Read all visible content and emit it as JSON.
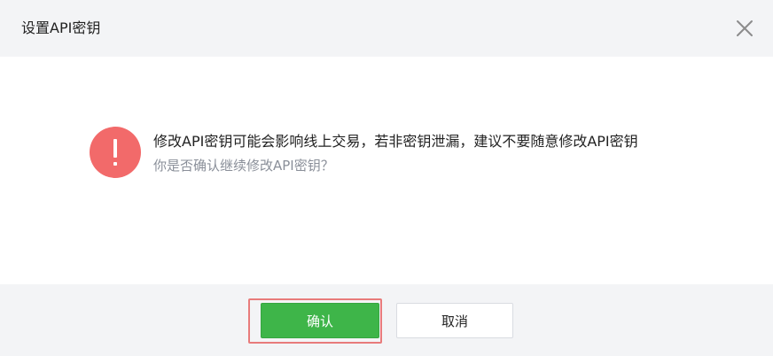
{
  "dialog": {
    "title": "设置API密钥",
    "close_icon": "close-icon",
    "warning_icon": "exclamation-icon",
    "message_main": "修改API密钥可能会影响线上交易，若非密钥泄漏，建议不要随意修改API密钥",
    "message_sub": "你是否确认继续修改API密钥？",
    "confirm_label": "确认",
    "cancel_label": "取消"
  },
  "colors": {
    "header_bg": "#f3f4f6",
    "footer_bg": "#f3f4f6",
    "warning": "#f26a6a",
    "confirm": "#3eb549",
    "highlight": "#e87b7b",
    "sub_text": "#8a8f99"
  }
}
